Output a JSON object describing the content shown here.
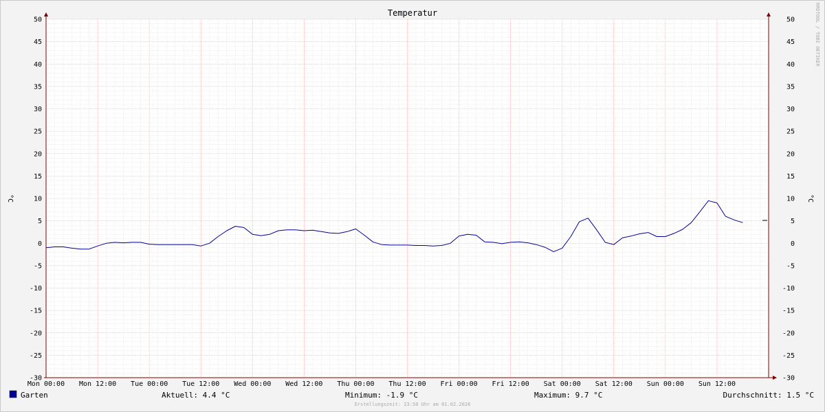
{
  "chart_data": {
    "type": "line",
    "title": "Temperatur",
    "ylabel": "°C",
    "ylim": [
      -30,
      50
    ],
    "y_ticks": [
      50,
      45,
      40,
      35,
      30,
      25,
      20,
      15,
      10,
      5,
      0,
      -5,
      -10,
      -15,
      -20,
      -25,
      -30
    ],
    "x_tick_labels": [
      "Mon 00:00",
      "Mon 12:00",
      "Tue 00:00",
      "Tue 12:00",
      "Wed 00:00",
      "Wed 12:00",
      "Thu 00:00",
      "Thu 12:00",
      "Fri 00:00",
      "Fri 12:00",
      "Sat 00:00",
      "Sat 12:00",
      "Sun 00:00",
      "Sun 12:00"
    ],
    "x_unit": "hours since Mon 00:00",
    "xlim": [
      0,
      168
    ],
    "grid": true,
    "series": [
      {
        "name": "Garten",
        "color": "#000099",
        "x": [
          0,
          2,
          4,
          6,
          8,
          10,
          12,
          14,
          16,
          18,
          20,
          22,
          24,
          26,
          28,
          30,
          32,
          34,
          36,
          38,
          40,
          42,
          44,
          46,
          48,
          50,
          52,
          54,
          56,
          58,
          60,
          62,
          64,
          66,
          68,
          70,
          72,
          74,
          76,
          78,
          80,
          82,
          84,
          86,
          88,
          90,
          92,
          94,
          96,
          98,
          100,
          102,
          104,
          106,
          108,
          110,
          112,
          114,
          116,
          118,
          120,
          122,
          124,
          126,
          128,
          130,
          132,
          134,
          136,
          138,
          140,
          142,
          144,
          146,
          148,
          150,
          152,
          154,
          156,
          158,
          160,
          162
        ],
        "y": [
          -1.0,
          -0.8,
          -0.8,
          -1.1,
          -1.3,
          -1.3,
          -0.6,
          0.0,
          0.2,
          0.1,
          0.2,
          0.2,
          -0.2,
          -0.3,
          -0.3,
          -0.3,
          -0.3,
          -0.3,
          -0.6,
          0.0,
          1.5,
          2.8,
          3.8,
          3.5,
          2.0,
          1.7,
          2.0,
          2.8,
          3.0,
          3.0,
          2.8,
          2.9,
          2.6,
          2.3,
          2.2,
          2.6,
          3.2,
          1.8,
          0.3,
          -0.3,
          -0.4,
          -0.4,
          -0.4,
          -0.5,
          -0.5,
          -0.6,
          -0.5,
          0.0,
          1.6,
          2.0,
          1.8,
          0.3,
          0.2,
          -0.1,
          0.2,
          0.3,
          0.1,
          -0.3,
          -0.9,
          -1.9,
          -1.1,
          1.5,
          4.8,
          5.6,
          3.0,
          0.2,
          -0.3,
          1.2,
          1.6,
          2.1,
          2.4,
          1.5,
          1.5,
          2.2,
          3.1,
          4.6,
          7.0,
          9.5,
          9.0,
          6.0,
          5.2,
          4.6
        ]
      }
    ],
    "legend": {
      "series_name": "Garten",
      "current": "Aktuell: 4.4 °C",
      "minimum": "Minimum: -1.9 °C",
      "maximum": "Maximum: 9.7 °C",
      "average": "Durchschnitt: 1.5 °C"
    },
    "footer": "Erstellungszeit: 23:58 Uhr am 01.02.2026",
    "watermark": "RRDTOOL / TOBI OETIKER",
    "colors": {
      "series": "#000099",
      "minor_grid": "#dddddd",
      "major_grid": "#ff9999",
      "axis": "#800000"
    }
  }
}
